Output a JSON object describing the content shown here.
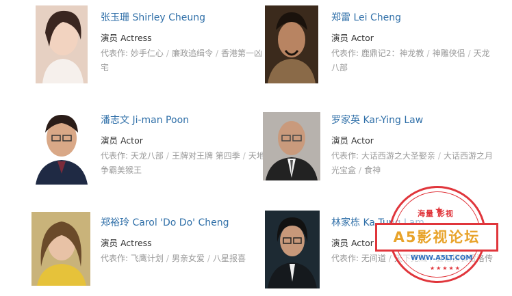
{
  "works_label": "代表作:",
  "cast": [
    {
      "name": "张玉珊 Shirley Cheung",
      "role": "演员 Actress",
      "works": [
        "妙手仁心",
        "廉政追缉令",
        "香港第一凶宅"
      ]
    },
    {
      "name": "郑雷 Lei Cheng",
      "role": "演员 Actor",
      "works": [
        "鹿鼎记2：神龙教",
        "神雕侠侣",
        "天龙八部"
      ]
    },
    {
      "name": "潘志文 Ji-man Poon",
      "role": "演员 Actor",
      "works": [
        "天龙八部",
        "王牌对王牌 第四季",
        "天地争霸美猴王"
      ]
    },
    {
      "name": "罗家英 Kar-Ying Law",
      "role": "演员 Actor",
      "works": [
        "大话西游之大圣娶亲",
        "大话西游之月光宝盒",
        "食神"
      ]
    },
    {
      "name": "郑裕玲 Carol 'Do Do' Cheng",
      "role": "演员 Actress",
      "works": [
        "飞鹰计划",
        "男亲女爱",
        "八星报喜"
      ]
    },
    {
      "name": "林家栋 Ka Tung Lam",
      "role": "演员 Actor",
      "works": [
        "无间道",
        "天下无贼",
        "五亿探长雷洛传"
      ]
    }
  ],
  "watermark": {
    "top_text": "海量 影视",
    "banner_text": "A5影视论坛",
    "url": "WWW.A5LT.COM"
  },
  "colors": {
    "name_link": "#2f6fa8",
    "muted_text": "#999999",
    "stamp_red": "#e0353b",
    "stamp_gold": "#e8a32a"
  }
}
